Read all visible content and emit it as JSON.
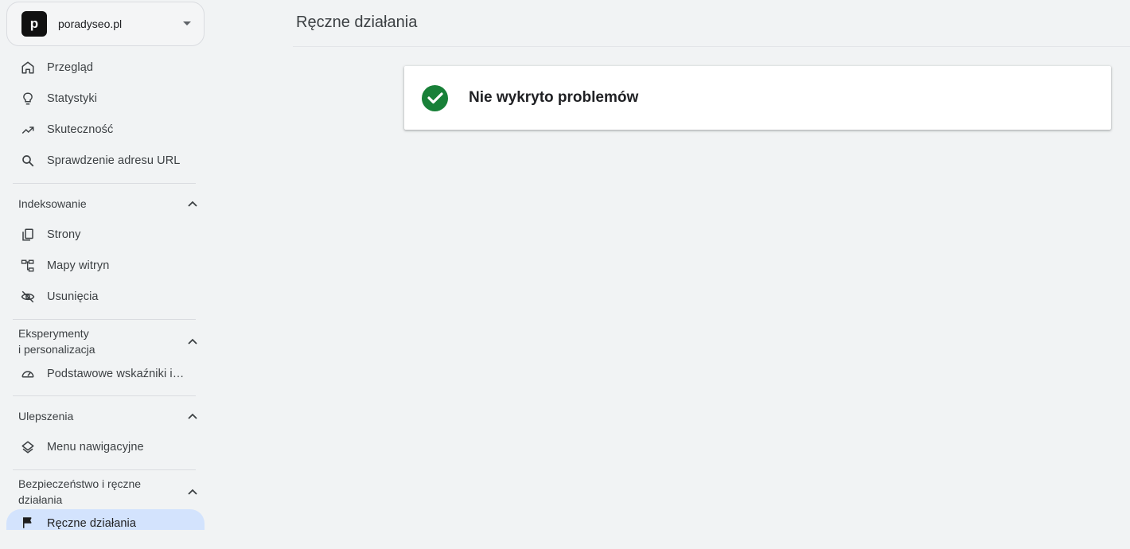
{
  "property": {
    "avatar_letter": "p",
    "name": "poradyseo.pl"
  },
  "nav": {
    "top_items": [
      {
        "label": "Przegląd",
        "icon": "home-icon"
      },
      {
        "label": "Statystyki",
        "icon": "lightbulb-icon"
      },
      {
        "label": "Skuteczność",
        "icon": "trending-up-icon"
      },
      {
        "label": "Sprawdzenie adresu URL",
        "icon": "search-icon"
      }
    ],
    "sections": [
      {
        "title": "Indeksowanie",
        "items": [
          {
            "label": "Strony",
            "icon": "pages-icon"
          },
          {
            "label": "Mapy witryn",
            "icon": "sitemap-icon"
          },
          {
            "label": "Usunięcia",
            "icon": "eye-off-icon"
          }
        ]
      },
      {
        "title_line1": "Eksperymenty",
        "title_line2": "i personalizacja",
        "items": [
          {
            "label": "Podstawowe wskaźniki i…",
            "icon": "speedometer-icon"
          }
        ]
      },
      {
        "title": "Ulepszenia",
        "items": [
          {
            "label": "Menu nawigacyjne",
            "icon": "layers-icon"
          }
        ]
      },
      {
        "title_line1": "Bezpieczeństwo i ręczne",
        "title_line2": "działania",
        "items": [
          {
            "label": "Ręczne działania",
            "icon": "flag-icon",
            "active": true
          }
        ]
      }
    ]
  },
  "main": {
    "title": "Ręczne działania",
    "status": {
      "text": "Nie wykryto problemów",
      "icon": "check-circle-icon",
      "color": "#188038"
    }
  },
  "colors": {
    "active_bg": "#d3e3fd",
    "page_bg": "#f1f3f4",
    "success": "#188038"
  }
}
